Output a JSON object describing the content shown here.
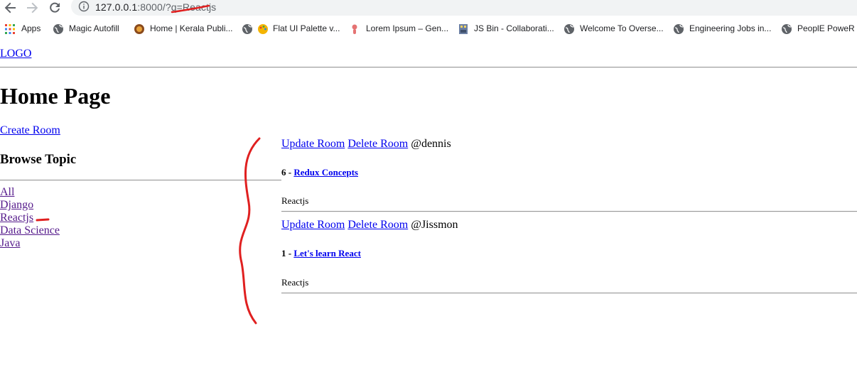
{
  "browser": {
    "url_host": "127.0.0.1",
    "url_rest": ":8000/?q=Reactjs",
    "bookmarks": [
      {
        "label": "Apps",
        "icon": "apps-grid-icon"
      },
      {
        "label": "Magic Autofill",
        "icon": "globe-icon"
      },
      {
        "label": "Home | Kerala Publi...",
        "icon": "kerala-emblem-icon"
      },
      {
        "label": "Flat UI Palette v...",
        "icon": "palette-icon"
      },
      {
        "label": "Lorem Ipsum – Gen...",
        "icon": "lorem-ipsum-icon"
      },
      {
        "label": "JS Bin - Collaborati...",
        "icon": "jsbin-icon"
      },
      {
        "label": "Welcome To Overse...",
        "icon": "globe-icon"
      },
      {
        "label": "Engineering Jobs in...",
        "icon": "globe-icon"
      },
      {
        "label": "PeoplE PoweR -",
        "icon": "globe-icon"
      }
    ]
  },
  "header": {
    "logo": "LOGO"
  },
  "main": {
    "title": "Home Page",
    "create_room": "Create Room",
    "browse_title": "Browse Topic",
    "topics": [
      "All",
      "Django",
      "Reactjs",
      "Data Science",
      "Java"
    ]
  },
  "rooms": [
    {
      "update": "Update Room",
      "delete": "Delete Room",
      "host": "@dennis",
      "prefix": "6 - ",
      "name": "Redux Concepts",
      "topic": "Reactjs"
    },
    {
      "update": "Update Room",
      "delete": "Delete Room",
      "host": "@Jissmon",
      "prefix": "1 - ",
      "name": "Let's learn React",
      "topic": "Reactjs"
    }
  ],
  "colors": {
    "link": "#0000ee",
    "visited_link": "#551a8b",
    "annotation": "#e02020",
    "omnibox": "#f1f3f4"
  }
}
